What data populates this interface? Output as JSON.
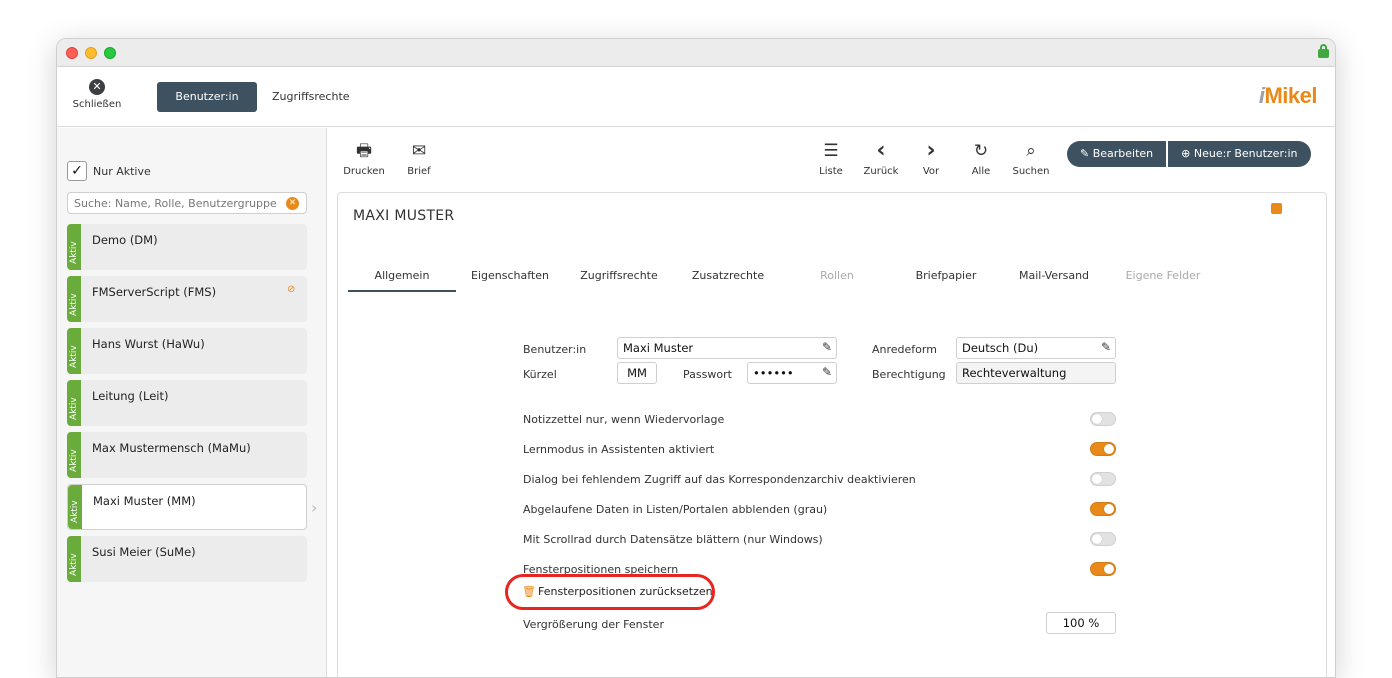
{
  "header": {
    "close_label": "Schließen",
    "tab_active": "Benutzer:in",
    "tab_other": "Zugriffsrechte",
    "logo_prefix": "i",
    "logo_text": "Mikel"
  },
  "sidebar": {
    "only_active_label": "Nur Aktive",
    "only_active_checked": true,
    "search_placeholder": "Suche: Name, Rolle, Benutzergruppe",
    "status_label": "Aktiv",
    "users": [
      {
        "name": "Demo (DM)",
        "hidden": false,
        "selected": false
      },
      {
        "name": "FMServerScript (FMS)",
        "hidden": true,
        "selected": false
      },
      {
        "name": "Hans Wurst (HaWu)",
        "hidden": false,
        "selected": false
      },
      {
        "name": "Leitung (Leit)",
        "hidden": false,
        "selected": false
      },
      {
        "name": "Max Mustermensch (MaMu)",
        "hidden": false,
        "selected": false
      },
      {
        "name": "Maxi Muster (MM)",
        "hidden": false,
        "selected": true
      },
      {
        "name": "Susi Meier (SuMe)",
        "hidden": false,
        "selected": false
      }
    ]
  },
  "toolbar": {
    "print": "Drucken",
    "letter": "Brief",
    "list": "Liste",
    "back": "Zurück",
    "forward": "Vor",
    "all": "Alle",
    "search": "Suchen",
    "edit": "Bearbeiten",
    "new_user": "Neue:r Benutzer:in"
  },
  "record": {
    "title": "MAXI MUSTER",
    "tabs": [
      {
        "label": "Allgemein",
        "state": "active"
      },
      {
        "label": "Eigenschaften",
        "state": "normal"
      },
      {
        "label": "Zugriffsrechte",
        "state": "normal"
      },
      {
        "label": "Zusatzrechte",
        "state": "normal"
      },
      {
        "label": "Rollen",
        "state": "disabled"
      },
      {
        "label": "Briefpapier",
        "state": "normal"
      },
      {
        "label": "Mail-Versand",
        "state": "normal"
      },
      {
        "label": "Eigene Felder",
        "state": "disabled"
      }
    ],
    "fields": {
      "user_label": "Benutzer:in",
      "user_value": "Maxi Muster",
      "salutation_label": "Anredeform",
      "salutation_value": "Deutsch (Du)",
      "short_label": "Kürzel",
      "short_value": "MM",
      "password_label": "Passwort",
      "password_value": "••••••",
      "permission_label": "Berechtigung",
      "permission_value": "Rechteverwaltung"
    },
    "settings": [
      {
        "label": "Notizzettel nur, wenn Wiedervorlage",
        "on": false
      },
      {
        "label": "Lernmodus in Assistenten aktiviert",
        "on": true
      },
      {
        "label": "Dialog bei fehlendem Zugriff auf das Korrespondenzarchiv deaktivieren",
        "on": false
      },
      {
        "label": "Abgelaufene Daten in Listen/Portalen abblenden (grau)",
        "on": true
      },
      {
        "label": "Mit Scrollrad durch Datensätze blättern (nur Windows)",
        "on": false
      },
      {
        "label": "Fensterpositionen speichern",
        "on": true
      }
    ],
    "reset_positions": "Fensterpositionen zurücksetzen",
    "zoom_label": "Vergrößerung der Fenster",
    "zoom_value": "100 %"
  },
  "colors": {
    "accent": "#e8891a",
    "primary": "#3e5160",
    "active_green": "#6aac3b",
    "highlight_ring": "#e6261f"
  }
}
